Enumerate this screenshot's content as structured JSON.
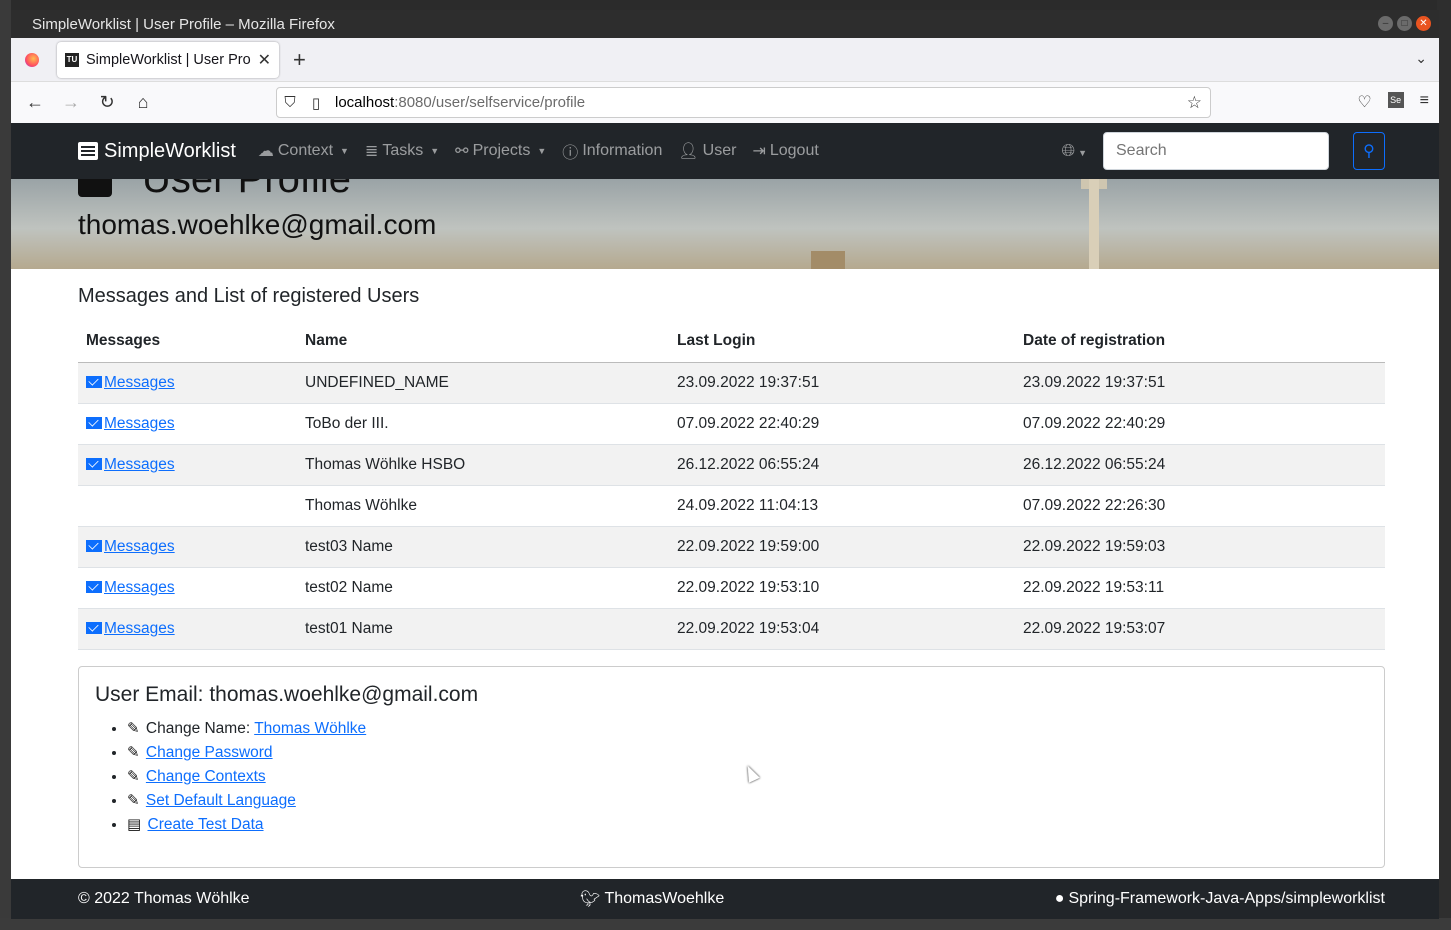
{
  "window": {
    "title": "SimpleWorklist | User Profile – Mozilla Firefox"
  },
  "browser": {
    "tab_title": "SimpleWorklist | User Pro",
    "tab_favicon": "TU",
    "url_host": "localhost",
    "url_path": ":8080/user/selfservice/profile"
  },
  "app": {
    "brand": "SimpleWorklist",
    "nav": {
      "context": "Context",
      "tasks": "Tasks",
      "projects": "Projects",
      "information": "Information",
      "user": "User",
      "logout": "Logout"
    },
    "search_placeholder": "Search"
  },
  "hero": {
    "heading": "User Profile",
    "email": "thomas.woehlke@gmail.com"
  },
  "users_section": {
    "title": "Messages and List of registered Users",
    "columns": [
      "Messages",
      "Name",
      "Last Login",
      "Date of registration"
    ],
    "rows": [
      {
        "messages": "Messages",
        "name": "UNDEFINED_NAME",
        "last_login": "23.09.2022 19:37:51",
        "registered": "23.09.2022 19:37:51"
      },
      {
        "messages": "Messages",
        "name": "ToBo der III.",
        "last_login": "07.09.2022 22:40:29",
        "registered": "07.09.2022 22:40:29"
      },
      {
        "messages": "Messages",
        "name": "Thomas Wöhlke HSBO",
        "last_login": "26.12.2022 06:55:24",
        "registered": "26.12.2022 06:55:24"
      },
      {
        "messages": "",
        "name": "Thomas Wöhlke",
        "last_login": "24.09.2022 11:04:13",
        "registered": "07.09.2022 22:26:30"
      },
      {
        "messages": "Messages",
        "name": "test03 Name",
        "last_login": "22.09.2022 19:59:00",
        "registered": "22.09.2022 19:59:03"
      },
      {
        "messages": "Messages",
        "name": "test02 Name",
        "last_login": "22.09.2022 19:53:10",
        "registered": "22.09.2022 19:53:11"
      },
      {
        "messages": "Messages",
        "name": "test01 Name",
        "last_login": "22.09.2022 19:53:04",
        "registered": "22.09.2022 19:53:07"
      }
    ]
  },
  "user_card": {
    "title": "User Email: thomas.woehlke@gmail.com",
    "change_name_label": "Change Name:",
    "change_name_link": "Thomas Wöhlke",
    "change_password": "Change Password",
    "change_contexts": "Change Contexts",
    "set_default_language": "Set Default Language",
    "create_test_data": "Create Test Data"
  },
  "footer": {
    "copyright": "© 2022 Thomas Wöhlke",
    "twitter": "ThomasWoehlke",
    "github": "Spring-Framework-Java-Apps/simpleworklist"
  },
  "colors": {
    "navbar": "#212529",
    "link": "#0d6efd",
    "close_button": "#e95420"
  }
}
